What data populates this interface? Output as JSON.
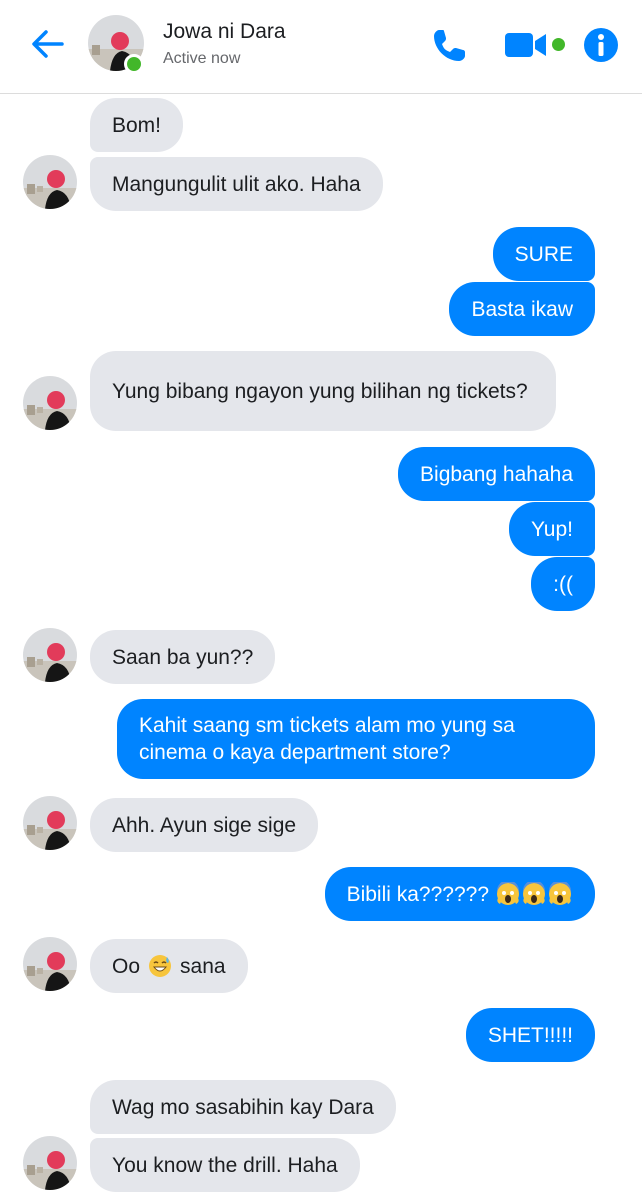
{
  "header": {
    "contact_name": "Jowa ni Dara",
    "status": "Active now",
    "accent_color": "#0084ff",
    "online_color": "#42b72a",
    "icons": [
      "back-arrow-icon",
      "phone-icon",
      "video-camera-icon",
      "info-icon"
    ]
  },
  "colors": {
    "incoming_bubble": "#e4e6eb",
    "outgoing_bubble": "#0084ff"
  },
  "messages": [
    {
      "from": "contact",
      "text": "Bom!"
    },
    {
      "from": "contact",
      "text": "Mangungulit ulit ako. Haha"
    },
    {
      "from": "me",
      "text": "SURE"
    },
    {
      "from": "me",
      "text": "Basta ikaw"
    },
    {
      "from": "contact",
      "text": "Yung bibang ngayon yung bilihan ng tickets?"
    },
    {
      "from": "me",
      "text": "Bigbang hahaha"
    },
    {
      "from": "me",
      "text": "Yup!"
    },
    {
      "from": "me",
      "text": ":(("
    },
    {
      "from": "contact",
      "text": "Saan ba yun??"
    },
    {
      "from": "me",
      "text": "Kahit saang sm tickets alam mo yung sa cinema o kaya department store?"
    },
    {
      "from": "contact",
      "text": "Ahh. Ayun sige sige"
    },
    {
      "from": "me",
      "text": "Bibili ka??????",
      "emoji": [
        "screaming-face",
        "screaming-face",
        "screaming-face"
      ]
    },
    {
      "from": "contact",
      "text_before": "Oo",
      "emoji": [
        "grinning-sweat-face"
      ],
      "text_after": "sana"
    },
    {
      "from": "me",
      "text": "SHET!!!!!"
    },
    {
      "from": "contact",
      "text": "Wag mo sasabihin kay Dara"
    },
    {
      "from": "contact",
      "text": "You know the drill. Haha"
    }
  ]
}
